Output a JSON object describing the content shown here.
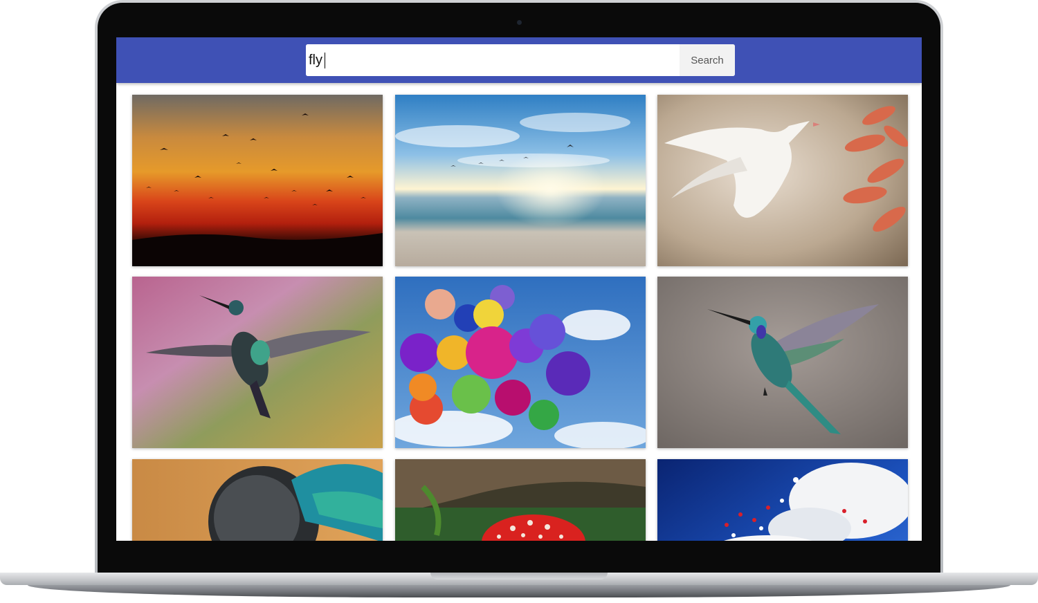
{
  "search": {
    "query": "fly",
    "button_label": "Search"
  },
  "theme": {
    "header_color": "#3f51b5"
  },
  "results": [
    {
      "subject": "sunset-birds-image"
    },
    {
      "subject": "beach-sunrise-gulls-image"
    },
    {
      "subject": "white-dove-image"
    },
    {
      "subject": "hummingbird-pink-image"
    },
    {
      "subject": "heart-balloons-image"
    },
    {
      "subject": "hummingbird-flight-image"
    },
    {
      "subject": "fly-eye-macro-image"
    },
    {
      "subject": "red-mushroom-image"
    },
    {
      "subject": "sky-balloons-image"
    }
  ]
}
